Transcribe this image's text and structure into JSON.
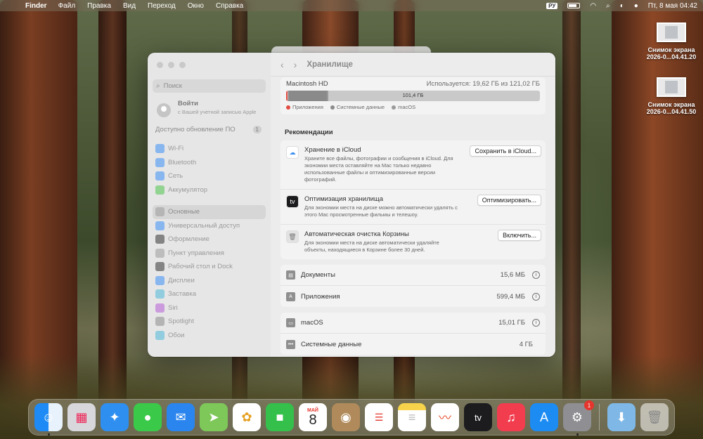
{
  "menubar": {
    "app_name": "Finder",
    "menus": [
      "Файл",
      "Правка",
      "Вид",
      "Переход",
      "Окно",
      "Справка"
    ],
    "input_lang": "РУ",
    "datetime": "Пт, 8 мая  04:42"
  },
  "desktop": {
    "items": [
      {
        "line1": "Снимок экрана",
        "line2": "2026-0...04.41.20"
      },
      {
        "line1": "Снимок экрана",
        "line2": "2026-0...04.41.50"
      }
    ]
  },
  "sidebar": {
    "search_placeholder": "Поиск",
    "login_title": "Войти",
    "login_subtitle": "с Вашей учетной записью Apple",
    "update_label": "Доступно обновление ПО",
    "update_count": "1",
    "group1": [
      {
        "label": "Wi-Fi",
        "icon": "wifi-icon",
        "color": "#3b8ef5"
      },
      {
        "label": "Bluetooth",
        "icon": "bluetooth-icon",
        "color": "#3b8ef5"
      },
      {
        "label": "Сеть",
        "icon": "globe-icon",
        "color": "#3b8ef5"
      },
      {
        "label": "Аккумулятор",
        "icon": "battery-icon",
        "color": "#4cc24c"
      }
    ],
    "group2": [
      {
        "label": "Основные",
        "icon": "gear-icon",
        "color": "#9a9a9a",
        "selected": true
      },
      {
        "label": "Универсальный доступ",
        "icon": "accessibility-icon",
        "color": "#3b8ef5"
      },
      {
        "label": "Оформление",
        "icon": "appearance-icon",
        "color": "#333333"
      },
      {
        "label": "Пункт управления",
        "icon": "control-center-icon",
        "color": "#9a9a9a"
      },
      {
        "label": "Рабочий стол и Dock",
        "icon": "desktop-dock-icon",
        "color": "#333333"
      },
      {
        "label": "Дисплеи",
        "icon": "display-icon",
        "color": "#3b8ef5"
      },
      {
        "label": "Заставка",
        "icon": "screensaver-icon",
        "color": "#4bb8d8"
      },
      {
        "label": "Siri",
        "icon": "siri-icon",
        "color": "#b45cd6"
      },
      {
        "label": "Spotlight",
        "icon": "spotlight-icon",
        "color": "#8a8a8a"
      },
      {
        "label": "Обои",
        "icon": "wallpaper-icon",
        "color": "#4bb8d8"
      }
    ]
  },
  "content": {
    "title": "Хранилище",
    "disk": {
      "name": "Macintosh HD",
      "used_text": "Используется: 19,62 ГБ из 121,02 ГБ",
      "free_label": "101,4 ГБ",
      "legend": [
        {
          "label": "Приложения",
          "color": "#e34b41"
        },
        {
          "label": "Системные данные",
          "color": "#8a8a8a"
        },
        {
          "label": "macOS",
          "color": "#9a9a9a"
        }
      ]
    },
    "recommendations_title": "Рекомендации",
    "recommendations": [
      {
        "title": "Хранение в iCloud",
        "desc": "Храните все файлы, фотографии и сообщения в iCloud. Для экономии места оставляйте на Mac только недавно использованные файлы и оптимизированные версии фотографий.",
        "button": "Сохранить в iCloud...",
        "icon": "icloud-icon",
        "color": "#ffffff"
      },
      {
        "title": "Оптимизация хранилища",
        "desc": "Для экономии места на диске можно автоматически удалять с этого Mac просмотренные фильмы и телешоу.",
        "button": "Оптимизировать...",
        "icon": "appletv-icon",
        "color": "#1c1c1e"
      },
      {
        "title": "Автоматическая очистка Корзины",
        "desc": "Для экономии места на диске автоматически удаляйте объекты, находящиеся в Корзине более 30 дней.",
        "button": "Включить...",
        "icon": "trash-icon",
        "color": "#e2e2e2"
      }
    ],
    "items_group1": [
      {
        "name": "Документы",
        "size": "15,6 МБ",
        "icon": "document-icon"
      },
      {
        "name": "Приложения",
        "size": "599,4 МБ",
        "icon": "applications-icon"
      }
    ],
    "items_group2": [
      {
        "name": "macOS",
        "size": "15,01 ГБ",
        "icon": "laptop-icon"
      },
      {
        "name": "Системные данные",
        "size": "4 ГБ",
        "icon": "ellipsis-icon"
      }
    ]
  },
  "dock": {
    "calendar_month": "МАЙ",
    "calendar_day": "8",
    "settings_badge": "1",
    "tv_label": "tv"
  }
}
